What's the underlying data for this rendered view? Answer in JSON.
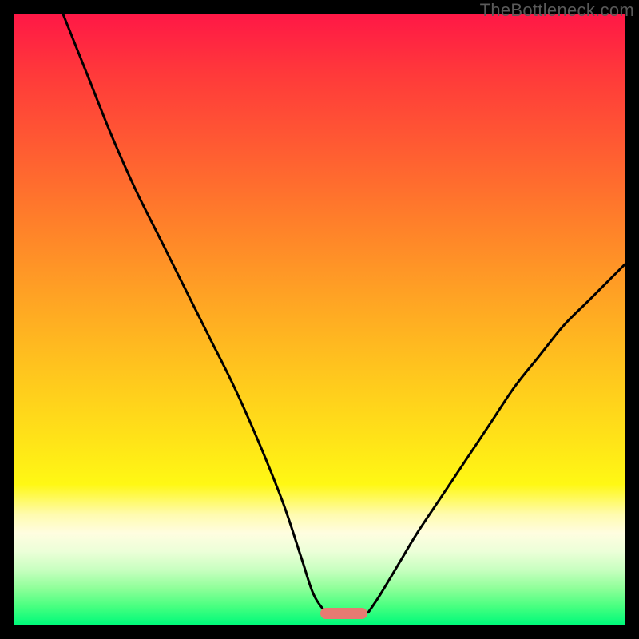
{
  "watermark": "TheBottleneck.com",
  "plot": {
    "inner_width": 764,
    "inner_height": 764,
    "x_range": [
      0,
      100
    ],
    "y_range": [
      0,
      100
    ]
  },
  "chart_data": {
    "type": "line",
    "title": "",
    "xlabel": "",
    "ylabel": "",
    "xlim": [
      0,
      100
    ],
    "ylim": [
      0,
      100
    ],
    "series": [
      {
        "name": "left-curve",
        "x": [
          8,
          12,
          16,
          20,
          24,
          28,
          32,
          36,
          40,
          44,
          47,
          49,
          51
        ],
        "values": [
          100,
          90,
          80,
          71,
          63,
          55,
          47,
          39,
          30,
          20,
          11,
          5,
          2
        ]
      },
      {
        "name": "right-curve",
        "x": [
          58,
          60,
          63,
          66,
          70,
          74,
          78,
          82,
          86,
          90,
          94,
          98,
          100
        ],
        "values": [
          2,
          5,
          10,
          15,
          21,
          27,
          33,
          39,
          44,
          49,
          53,
          57,
          59
        ]
      }
    ],
    "marker": {
      "name": "bottleneck-region",
      "x_center": 54,
      "y": 1.8,
      "width_pct": 7.8,
      "color": "#e77a72"
    },
    "gradient_stops": [
      {
        "pct": 0,
        "color": "#ff1846"
      },
      {
        "pct": 10,
        "color": "#ff3a3a"
      },
      {
        "pct": 22,
        "color": "#ff5c32"
      },
      {
        "pct": 34,
        "color": "#ff7f2a"
      },
      {
        "pct": 46,
        "color": "#ffa224"
      },
      {
        "pct": 58,
        "color": "#ffc41e"
      },
      {
        "pct": 70,
        "color": "#ffe418"
      },
      {
        "pct": 77,
        "color": "#fff814"
      },
      {
        "pct": 82,
        "color": "#fffbb0"
      },
      {
        "pct": 85,
        "color": "#fffde0"
      },
      {
        "pct": 88,
        "color": "#ecffd8"
      },
      {
        "pct": 91,
        "color": "#c8ffc0"
      },
      {
        "pct": 94,
        "color": "#90ff9a"
      },
      {
        "pct": 97,
        "color": "#48ff80"
      },
      {
        "pct": 100,
        "color": "#00fa7a"
      }
    ]
  }
}
